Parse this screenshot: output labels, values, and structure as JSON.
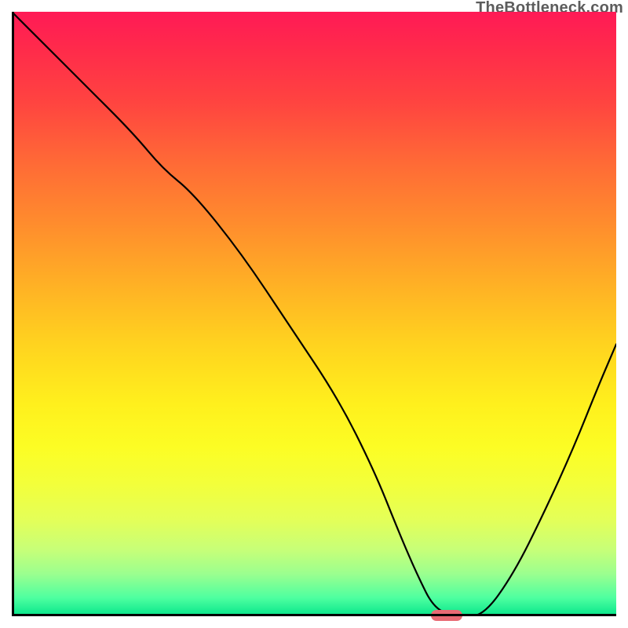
{
  "watermark": "TheBottleneck.com",
  "chart_data": {
    "type": "line",
    "title": "",
    "xlabel": "",
    "ylabel": "",
    "xlim": [
      0,
      100
    ],
    "ylim": [
      0,
      100
    ],
    "grid": false,
    "legend": false,
    "gradient_stops": [
      {
        "pct": 0,
        "color": "#ff1a56"
      },
      {
        "pct": 6,
        "color": "#ff2a4b"
      },
      {
        "pct": 15,
        "color": "#ff4440"
      },
      {
        "pct": 25,
        "color": "#ff6a36"
      },
      {
        "pct": 35,
        "color": "#ff8c2d"
      },
      {
        "pct": 45,
        "color": "#ffb025"
      },
      {
        "pct": 55,
        "color": "#ffd31f"
      },
      {
        "pct": 65,
        "color": "#fff01d"
      },
      {
        "pct": 72,
        "color": "#fcfd24"
      },
      {
        "pct": 78,
        "color": "#f3ff3a"
      },
      {
        "pct": 84,
        "color": "#e4ff58"
      },
      {
        "pct": 89,
        "color": "#c7ff78"
      },
      {
        "pct": 93,
        "color": "#9bff8f"
      },
      {
        "pct": 97,
        "color": "#4dffa0"
      },
      {
        "pct": 100,
        "color": "#06e58a"
      }
    ],
    "series": [
      {
        "name": "bottleneck-curve",
        "x": [
          0,
          5,
          12,
          20,
          25,
          30,
          38,
          46,
          54,
          60,
          64,
          67,
          70,
          74,
          78,
          83,
          88,
          93,
          97,
          100
        ],
        "y": [
          100,
          95,
          88,
          80,
          74,
          70,
          60,
          48,
          36,
          24,
          14,
          7,
          1,
          0,
          0,
          7,
          17,
          28,
          38,
          45
        ]
      }
    ],
    "marker": {
      "x": 72,
      "y": 0,
      "width_pct": 5.2,
      "height_pct": 1.8,
      "color": "#e86a74"
    }
  }
}
